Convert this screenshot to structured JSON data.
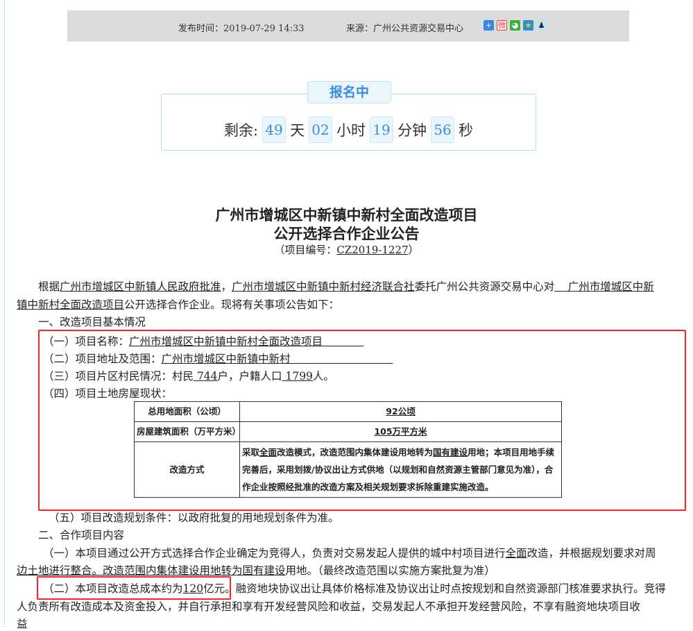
{
  "meta": {
    "publish_time": "发布时间：2019-07-29 14:33",
    "source": "来源：广州公共资源交易中心",
    "share_icons": [
      "plus-share-icon",
      "weibo-icon",
      "wechat-icon",
      "qzone-icon",
      "qq-icon"
    ]
  },
  "countdown": {
    "status": "报名中",
    "prefix": "剩余:",
    "days": "49",
    "days_unit": "天",
    "hours": "02",
    "hours_unit": "小时",
    "minutes": "19",
    "minutes_unit": "分钟",
    "seconds": "56",
    "seconds_unit": "秒"
  },
  "title": {
    "line1": "广州市增城区中新镇中新村全面改造项目",
    "line2": "公开选择合作企业公告",
    "code_prefix": "（项目编号：",
    "code": "CZ2019-1227",
    "code_suffix": "）"
  },
  "intro": {
    "a": "根据",
    "b": "广州市增城区中新镇人民政府批准",
    "c": "，",
    "d": "广州市增城区中新镇中新村经济联合社",
    "e": "委托广州公共资源交易中心对",
    "f": "    广州市增城区中新",
    "g": "镇中新村全面改造项目",
    "h": "公开选择合作企业",
    "i": "。现将有关事项公告如下："
  },
  "section1": {
    "heading": "一、改造项目基本情况",
    "item1_label": "（一）项目名称：",
    "item1_value": "广州市增城区中新镇中新村全面改造项目            ",
    "item2_label": "（二）项目地址及范围：",
    "item2_value": "广州市增城区中新镇中新村                              ",
    "item3_a": "（三）项目片区村民情况：村民",
    "item3_b": " 744",
    "item3_c": "户，户籍人口",
    "item3_d": " 1799",
    "item3_e": "人。",
    "item4": "（四）项目土地房屋现状：",
    "table": {
      "r1_label": "总用地面积（公顷）",
      "r1_value": "92公顷",
      "r2_label": "房屋建筑面积（万平方米）",
      "r2_value": "105万平方米",
      "r3_label": "改造方式",
      "r3_a": "采取",
      "r3_b": "全面",
      "r3_c": "改造模式，改造范围内集体建设用地转为",
      "r3_d": "国有建设",
      "r3_e": "用地；本项目用地手续完善后，采用划拨/协议出让方式供地（以规划和自然资源主管部门意见为准），合作企业按照经批准的改造方案及相关规划要求拆除重建实施改造。"
    },
    "item5": "（五）项目改造规划条件：以政府批复的用地规划条件为准。"
  },
  "section2": {
    "heading": "二、合作项目内容",
    "p1_a": "（一）本项目通过公开方式选择合作企业确定为竞得人，负责对交易发起人提供的城中村项目进行",
    "p1_b": "全面",
    "p1_c": "改造，并根据规划要求对周",
    "p1_d": "边土地进行整合。改造范围内集体建设用地转为",
    "p1_e": "国有建设",
    "p1_f": "用地。（最终改造范围以实施方案批复为准）",
    "p2_a": "（二）本项目改造总成本约为",
    "p2_b": "120",
    "p2_c": "亿元。",
    "p2_d": "融资地块协议出让具体价格标准及协议出让时点按规划和自然资源部门核准要求执行。竞得",
    "p2_e": "人负责所有改造成本及资金投入，并自行承担和享有开发经营风险和收益，交易发起人不承担开发经营风险，不享有融资地块项目收",
    "p2_f": "益"
  }
}
